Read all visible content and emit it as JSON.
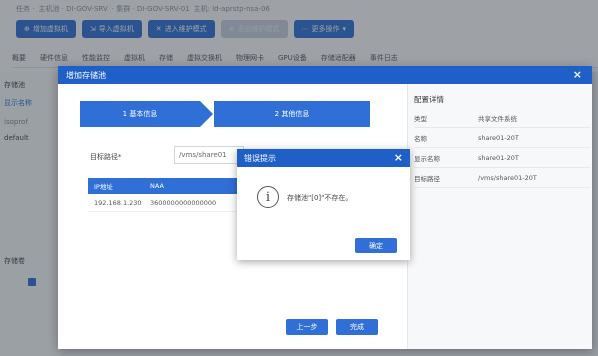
{
  "breadcrumb": [
    "任务 ·",
    "主机池 · DI-GOV-SRV",
    "· 集群 · DI-GOV-SRV-01",
    "主机: ld-aprstp-nsa-06"
  ],
  "toolbar": {
    "add_vm": "增加虚拟机",
    "import_vm": "导入虚拟机",
    "maintenance": "进入维护模式",
    "exit_maintenance": "退出维护模式",
    "more": "更多操作"
  },
  "tabs": [
    "概要",
    "硬件信息",
    "性能监控",
    "虚拟机",
    "存储",
    "虚拟交换机",
    "物理网卡",
    "GPU设备",
    "存储适配器",
    "事件日志"
  ],
  "left": {
    "storage_pool": "存储池",
    "display_name": "显示名称",
    "item1": "isoprof",
    "item2": "default",
    "storage_vol": "存储卷"
  },
  "dialog": {
    "title": "增加存储池",
    "close": "×",
    "step1": "1 基本信息",
    "step2": "2 其他信息",
    "path_label": "目标路径*",
    "path_value": "/vms/share01",
    "table_headers": [
      "IP地址",
      "NAA"
    ],
    "table_row": [
      "192.168.1.230",
      "3600000000000000"
    ],
    "btn_prev": "上一步",
    "btn_finish": "完成",
    "side": {
      "title": "配置详情",
      "rows": [
        {
          "k": "类型",
          "v": "共享文件系统"
        },
        {
          "k": "名称",
          "v": "share01-20T"
        },
        {
          "k": "显示名称",
          "v": "share01-20T"
        },
        {
          "k": "目标路径",
          "v": "/vms/share01-20T"
        }
      ]
    }
  },
  "error": {
    "title": "错误提示",
    "close": "×",
    "icon": "i",
    "message": "存储池\"[0]\"不存在。",
    "ok": "确定"
  },
  "colors": {
    "primary": "#2f6fd6",
    "header": "#1f5fc8",
    "overlay": "rgba(40,48,60,0.45)"
  }
}
